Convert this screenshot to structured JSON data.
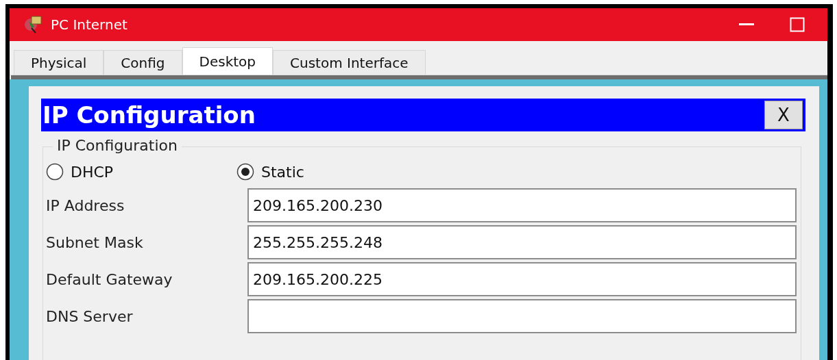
{
  "window": {
    "title": "PC Internet"
  },
  "tabs": [
    {
      "label": "Physical",
      "selected": false
    },
    {
      "label": "Config",
      "selected": false
    },
    {
      "label": "Desktop",
      "selected": true
    },
    {
      "label": "Custom Interface",
      "selected": false
    }
  ],
  "dialog": {
    "title": "IP Configuration",
    "close": "X",
    "group_title": "IP Configuration",
    "modes": [
      {
        "label": "DHCP",
        "selected": false
      },
      {
        "label": "Static",
        "selected": true
      }
    ],
    "fields": [
      {
        "label": "IP Address",
        "value": "209.165.200.230"
      },
      {
        "label": "Subnet Mask",
        "value": "255.255.255.248"
      },
      {
        "label": "Default Gateway",
        "value": "209.165.200.225"
      },
      {
        "label": "DNS Server"
      }
    ]
  }
}
